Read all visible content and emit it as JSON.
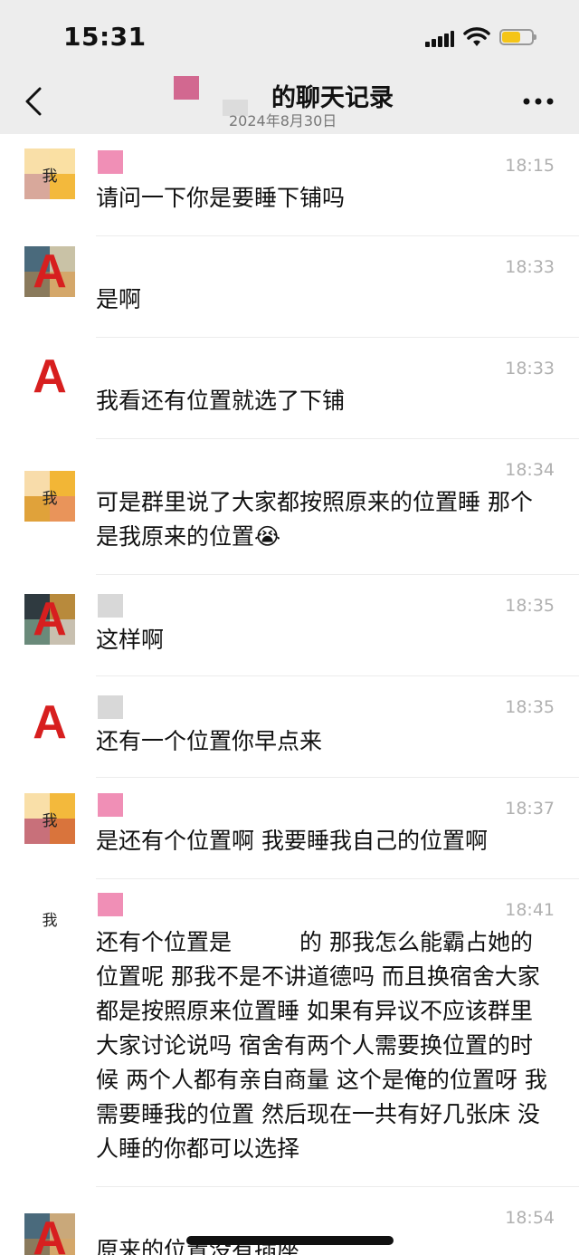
{
  "status_bar": {
    "time": "15:31"
  },
  "header": {
    "title": "的聊天记录",
    "subtitle": "2024年8月30日"
  },
  "messages": [
    {
      "avatar_text": "我",
      "time": "18:15",
      "text": "请问一下你是要睡下铺吗"
    },
    {
      "avatar_text": "A",
      "time": "18:33",
      "text": "是啊"
    },
    {
      "avatar_text": "A",
      "time": "18:33",
      "text": "我看还有位置就选了下铺"
    },
    {
      "avatar_text": "我",
      "time": "18:34",
      "text": "可是群里说了大家都按照原来的位置睡 那个是我原来的位置😭"
    },
    {
      "avatar_text": "A",
      "time": "18:35",
      "text": "这样啊"
    },
    {
      "avatar_text": "A",
      "time": "18:35",
      "text": "还有一个位置你早点来"
    },
    {
      "avatar_text": "我",
      "time": "18:37",
      "text": "是还有个位置啊 我要睡我自己的位置啊"
    },
    {
      "avatar_text": "我",
      "time": "18:41",
      "text": "还有个位置是　　　的 那我怎么能霸占她的位置呢 那我不是不讲道德吗 而且换宿舍大家都是按照原来位置睡 如果有异议不应该群里大家讨论说吗 宿舍有两个人需要换位置的时候 两个人都有亲自商量 这个是俺的位置呀 我需要睡我的位置 然后现在一共有好几张床 没人睡的你都可以选择"
    },
    {
      "avatar_text": "A",
      "time": "18:54",
      "text": "原来的位置没有插座"
    }
  ],
  "colors": {
    "header_bg": "#ededed",
    "avatar_A": "#d71f1f",
    "name_pink": "#f08fb6",
    "timestamp": "#b0b0b0"
  }
}
